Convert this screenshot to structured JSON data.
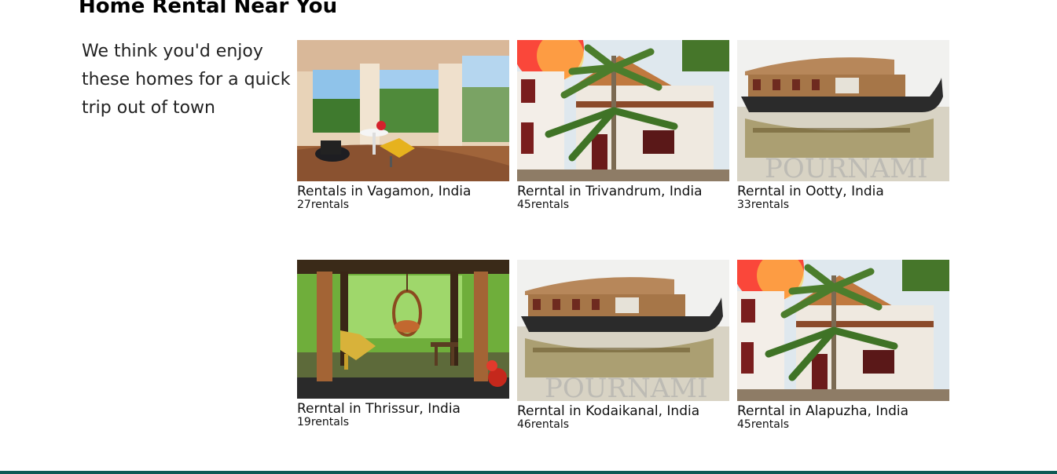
{
  "section": {
    "title": "Home Rental Near You",
    "tagline": "We think you'd enjoy these homes for a quick trip out of town"
  },
  "cards": [
    {
      "title": "Rentals in Vagamon, India",
      "count": "27rentals",
      "image": "balcony-room-photo"
    },
    {
      "title": "Rerntal in Trivandrum, India",
      "count": "45rentals",
      "image": "palm-villa-photo"
    },
    {
      "title": "Rerntal in Ootty, India",
      "count": "33rentals",
      "image": "houseboat-photo"
    },
    {
      "title": "Rerntal in Thrissur, India",
      "count": "19rentals",
      "image": "garden-pavilion-photo"
    },
    {
      "title": "Rerntal in Kodaikanal, India",
      "count": "46rentals",
      "image": "houseboat-photo"
    },
    {
      "title": "Rerntal in Alapuzha, India",
      "count": "45rentals",
      "image": "palm-villa-photo"
    }
  ],
  "watermark": "POURNAMI",
  "colors": {
    "footer": "#0f5a55",
    "text": "#111111"
  }
}
